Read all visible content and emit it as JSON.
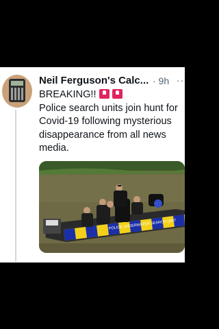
{
  "tweet": {
    "author": "Neil Ferguson's Calc...",
    "time": "· 9h",
    "more": "···",
    "lines": [
      "BREAKING!!",
      "Police search units join hunt for",
      "Covid-19 following mysterious",
      "disappearance from all news",
      "media."
    ]
  },
  "photo": {
    "boat_text": "POLICE UNDERWATER SEARCH UNIT"
  },
  "colors": {
    "siren": "#e0245e",
    "water": "#6e6a45",
    "boat_yellow": "#f3d11a",
    "boat_blue": "#1b2fa8"
  },
  "icons": [
    "calculator-avatar-icon",
    "siren-icon",
    "more-icon"
  ]
}
